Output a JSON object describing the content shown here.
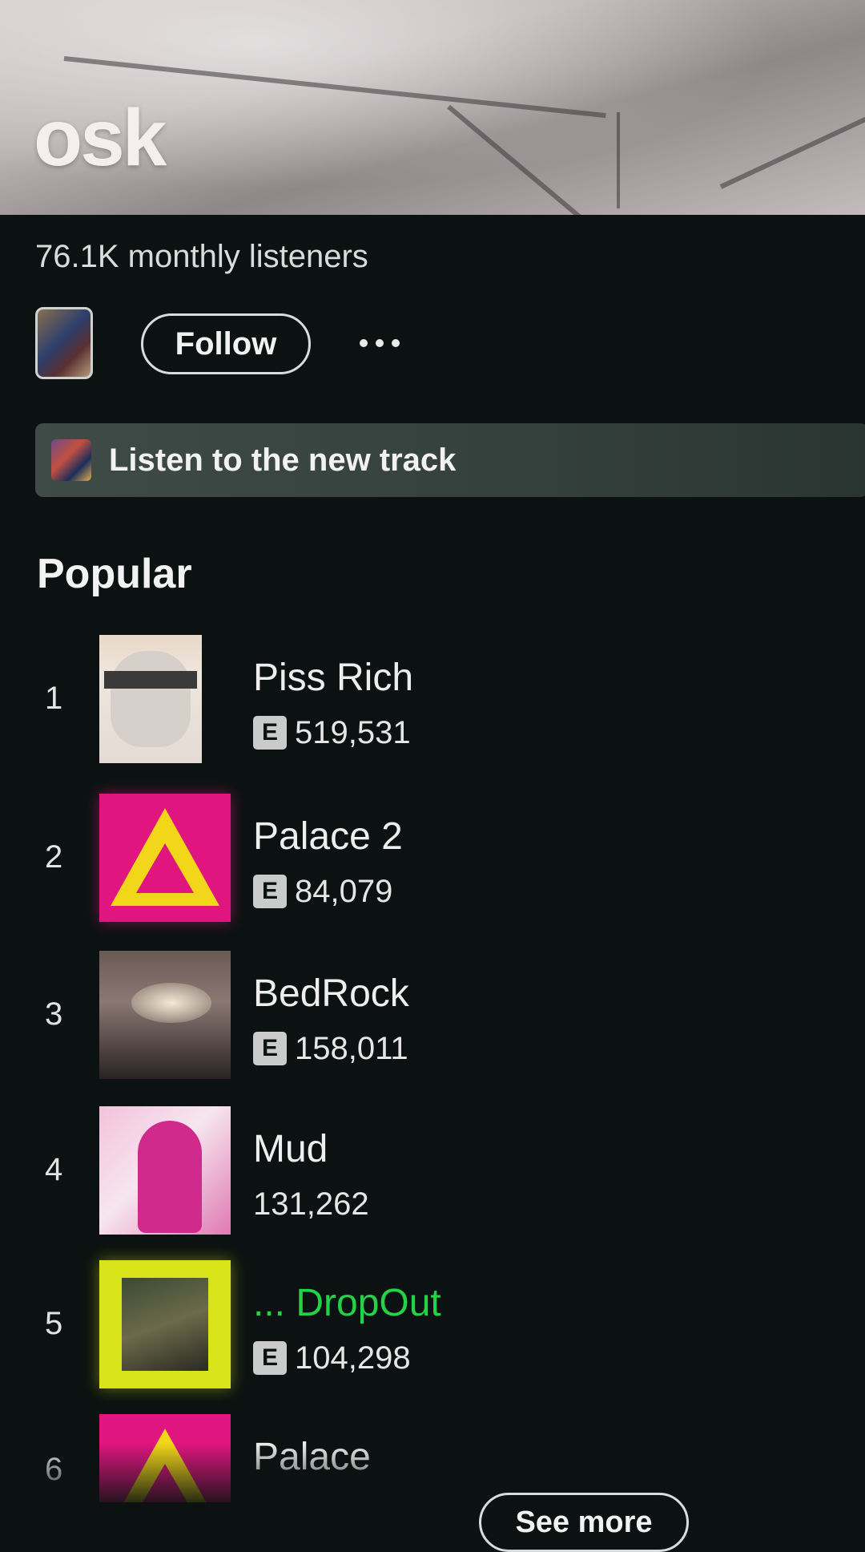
{
  "artist": {
    "name": "osk",
    "monthly_listeners": "76.1K monthly listeners",
    "follow_label": "Follow",
    "more_icon": "more-horizontal-icon"
  },
  "promo": {
    "label": "Listen to the new track"
  },
  "popular": {
    "title": "Popular",
    "tracks": [
      {
        "rank": "1",
        "title": "Piss Rich",
        "explicit": "E",
        "plays": "519,531"
      },
      {
        "rank": "2",
        "title": "Palace 2",
        "explicit": "E",
        "plays": "84,079"
      },
      {
        "rank": "3",
        "title": "BedRock",
        "explicit": "E",
        "plays": "158,011"
      },
      {
        "rank": "4",
        "title": "Mud",
        "explicit": "",
        "plays": "131,262"
      },
      {
        "rank": "5",
        "title": "... DropOut",
        "explicit": "E",
        "plays": "104,298",
        "playing": true
      },
      {
        "rank": "6",
        "title": "Palace",
        "explicit": "",
        "plays": ""
      }
    ],
    "see_more_label": "See more"
  },
  "colors": {
    "playing_green": "#25d146",
    "background": "#0b1211",
    "palace_pink": "#e0157f",
    "dropout_yellow": "#d9e31a"
  }
}
